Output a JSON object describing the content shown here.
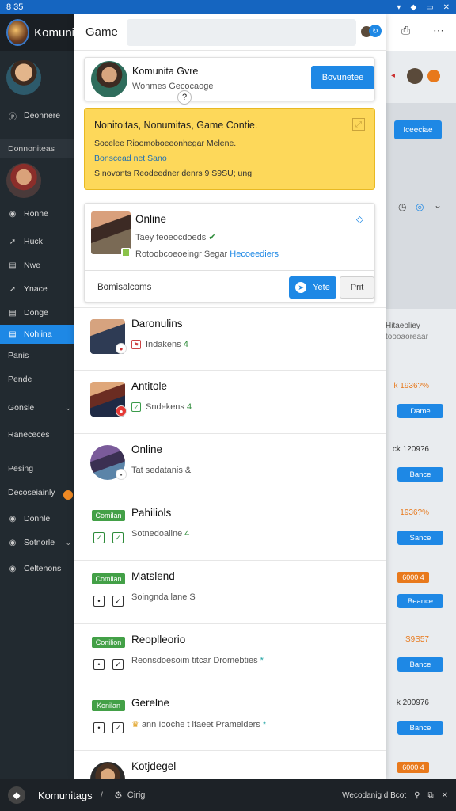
{
  "status_bar": {
    "time": "8 35"
  },
  "sidebar": {
    "brand": "Komuni",
    "items": [
      {
        "label": "Deonnere",
        "icon": "p-circle-icon"
      },
      {
        "label": "Donnoniteas",
        "icon": ""
      },
      {
        "label": "Ronne",
        "icon": "circle-icon"
      },
      {
        "label": "Huck",
        "icon": "arrow-icon"
      },
      {
        "label": "Nwe",
        "icon": "doc-icon"
      },
      {
        "label": "Ynace",
        "icon": "arrow-icon"
      },
      {
        "label": "Donge",
        "icon": "doc-icon"
      },
      {
        "label": "Nohlina",
        "icon": "doc-icon"
      },
      {
        "label": "Panis",
        "icon": ""
      },
      {
        "label": "Pende",
        "icon": ""
      },
      {
        "label": "Gonsle",
        "icon": ""
      },
      {
        "label": "Ranececes",
        "icon": ""
      },
      {
        "label": "Pesing",
        "icon": ""
      },
      {
        "label": "Decoseiainly",
        "icon": ""
      },
      {
        "label": "Donnle",
        "icon": "circle-icon"
      },
      {
        "label": "Sotnorle",
        "icon": "circle-icon"
      },
      {
        "label": "Celtenons",
        "icon": "circle-icon"
      }
    ]
  },
  "panel": {
    "title": "Game",
    "header_card": {
      "name": "Komunita Gvre",
      "subtitle": "Wonmes Gecocaoge",
      "button": "Bovunetee"
    },
    "notice": {
      "line1": "Nonitoitas, Nonumitas, Game Contie.",
      "line2": "Socelee Rioomoboeeonhegar Melene.",
      "line3": "Bonscead net Sano",
      "line4": "S novonts Reodeedner denrs 9 S9SU; ung"
    },
    "online_card": {
      "name": "Online",
      "line1": "Taey feoeocdoeds",
      "line2_prefix": "Rotoobcoeoeingr Segar",
      "line2_link": "Hecoeediers",
      "footer_label": "Bomisalcoms",
      "btn_primary": "Yete",
      "btn_secondary": "Prit"
    },
    "rows": [
      {
        "name": "Daronulins",
        "sub": "Indakens",
        "sub_mark": "4"
      },
      {
        "name": "Antitole",
        "sub": "Sndekens",
        "sub_mark": "4"
      },
      {
        "name": "Online",
        "sub": "Tat sedatanis",
        "sub_mark": "&"
      },
      {
        "name": "Pahiliols",
        "tag": "Comilan",
        "sub": "Sotnedoaline",
        "sub_mark": "4"
      },
      {
        "name": "Matslend",
        "tag": "Comilan",
        "sub": "Soingnda lane",
        "sub_mark": "S"
      },
      {
        "name": "Reoplleorio",
        "tag": "Conilion",
        "sub": "Reonsdoesoim titcar Dromebties",
        "sub_mark": "*"
      },
      {
        "name": "Gerelne",
        "tag": "Konilan",
        "sub": "ann Iooche t ifaeet Pramelders",
        "sub_mark": "*"
      },
      {
        "name": "Kotjdegel",
        "sub": "",
        "sub_mark": ""
      }
    ]
  },
  "right_column": {
    "top_button": "Iceeciae",
    "label": "Hitaeoliey",
    "label2": "toooaoreaar",
    "values": [
      {
        "text": "k 1936?%",
        "color": "orange",
        "button": "Dame"
      },
      {
        "text": "ck 1209?6",
        "color": "dark",
        "button": "Bance"
      },
      {
        "text": "1936?%",
        "color": "orange",
        "button": "Sance"
      },
      {
        "text": "6000 4",
        "color": "tag",
        "button": "Beance"
      },
      {
        "text": "S9S57",
        "color": "orange",
        "button": "Bance"
      },
      {
        "text": "k 200976",
        "color": "dark",
        "button": "Bance"
      },
      {
        "text": "6000 4",
        "color": "tag",
        "button": ""
      }
    ]
  },
  "bottom_bar": {
    "title": "Komunitags",
    "separator": "/",
    "sub": "Cirig",
    "right_text": "Wecodanig d Bcot"
  },
  "colors": {
    "accent": "#1e88e5",
    "sidebar_bg": "#222a30",
    "notice_bg": "#fdd85a",
    "tag_green": "#43a047",
    "value_orange": "#e8791c"
  }
}
